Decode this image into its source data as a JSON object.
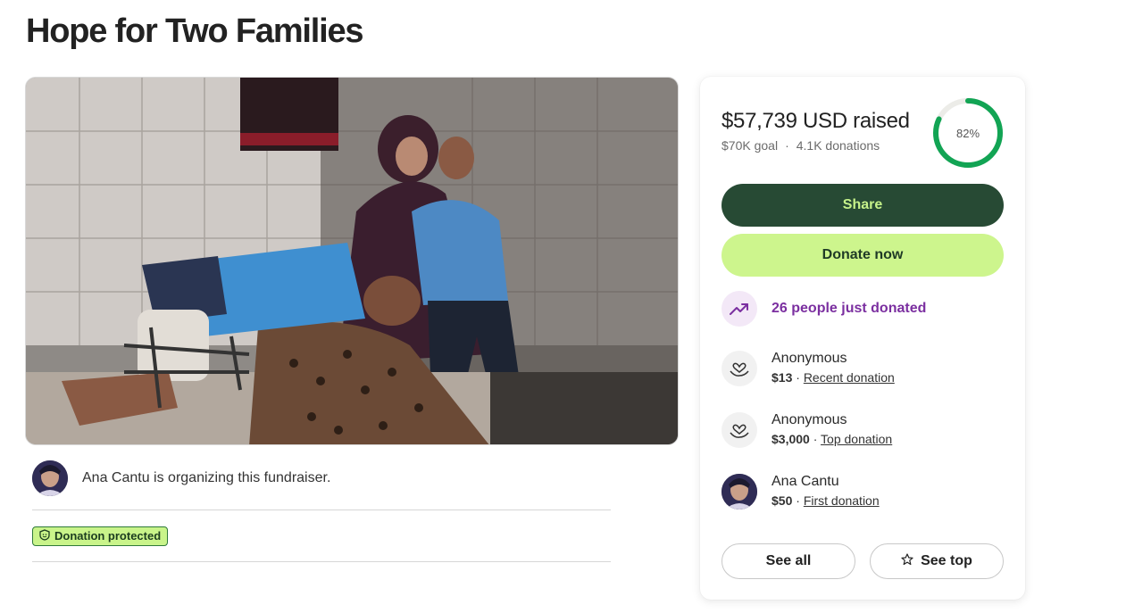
{
  "page": {
    "title": "Hope for Two Families"
  },
  "hero": {
    "image": "photo-mother-and-two-boys-injured-leg"
  },
  "organizer": {
    "text": "Ana Cantu is organizing this fundraiser."
  },
  "badge": {
    "label": "Donation protected",
    "icon": "shield-icon"
  },
  "card": {
    "raised": "$57,739 USD raised",
    "goal": "$70K goal",
    "separator": "·",
    "donations": "4.1K donations",
    "progress_label": "82%",
    "progress_value": 82,
    "share_label": "Share",
    "donate_label": "Donate now",
    "trend_text": "26 people just donated",
    "donors": [
      {
        "name": "Anonymous",
        "amount": "$13",
        "sep": " · ",
        "type": "Recent donation",
        "icon": "heart-hand-icon"
      },
      {
        "name": "Anonymous",
        "amount": "$3,000",
        "sep": " · ",
        "type": "Top donation",
        "icon": "heart-hand-icon"
      },
      {
        "name": "Ana Cantu",
        "amount": "$50",
        "sep": " · ",
        "type": "First donation",
        "icon": "avatar"
      }
    ],
    "see_all_label": "See all",
    "see_top_label": "See top"
  },
  "colors": {
    "share_bg": "#274a34",
    "donate_bg": "#cdf58d",
    "progress": "#12a454",
    "trend": "#7b2fa0"
  }
}
